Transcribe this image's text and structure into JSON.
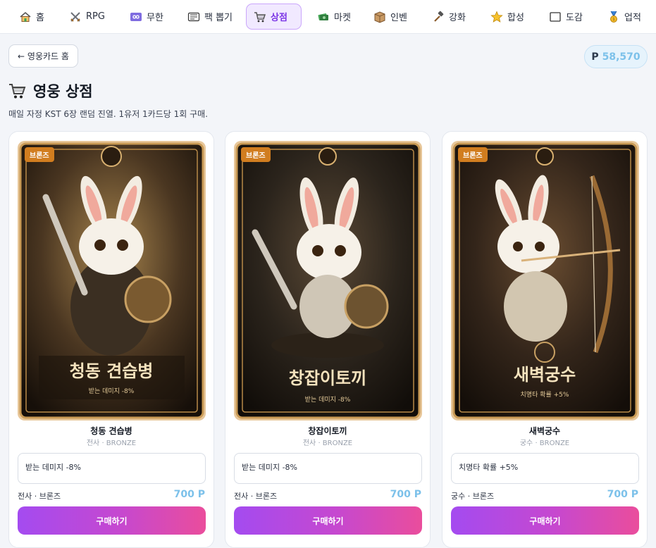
{
  "nav": {
    "items": [
      {
        "label": "홈",
        "icon": "home-icon"
      },
      {
        "label": "RPG",
        "icon": "crossed-swords-icon"
      },
      {
        "label": "무한",
        "icon": "infinity-icon"
      },
      {
        "label": "팩 뽑기",
        "icon": "card-pack-icon"
      },
      {
        "label": "상점",
        "icon": "shopping-cart-icon"
      },
      {
        "label": "마켓",
        "icon": "money-icon"
      },
      {
        "label": "인벤",
        "icon": "inventory-box-icon"
      },
      {
        "label": "강화",
        "icon": "hammer-icon"
      },
      {
        "label": "합성",
        "icon": "star-icon"
      },
      {
        "label": "도감",
        "icon": "book-icon"
      },
      {
        "label": "업적",
        "icon": "medal-icon"
      }
    ],
    "active": "상점"
  },
  "back_button": "← 영웅카드 홈",
  "points": {
    "symbol": "P",
    "value": "58,570"
  },
  "page": {
    "title": "영웅 상점",
    "title_icon": "shopping-cart-icon",
    "subtitle": "매일 자정 KST 6장 랜덤 진열. 1유저 1카드당 1회 구매."
  },
  "cards": [
    {
      "badge": "브론즈",
      "art_title": "청동 견습병",
      "art_caption": "받는 데미지 -8%",
      "name": "청동 견습병",
      "class_line": "전사 · BRONZE",
      "effect": "받는 데미지 -8%",
      "meta": "전사 · 브론즈",
      "price": "700 P",
      "buy_label": "구매하기",
      "art_icon": "sword-shield-rabbit-icon"
    },
    {
      "badge": "브론즈",
      "art_title": "창잡이토끼",
      "art_caption": "받는 데미지 -8%",
      "name": "창잡이토끼",
      "class_line": "전사 · BRONZE",
      "effect": "받는 데미지 -8%",
      "meta": "전사 · 브론즈",
      "price": "700 P",
      "buy_label": "구매하기",
      "art_icon": "sword-shield-rabbit-icon"
    },
    {
      "badge": "브론즈",
      "art_title": "새벽궁수",
      "art_caption": "치명타 확률 +5%",
      "name": "새벽궁수",
      "class_line": "궁수 · BRONZE",
      "effect": "치명타 확률 +5%",
      "meta": "궁수 · 브론즈",
      "price": "700 P",
      "buy_label": "구매하기",
      "art_icon": "archer-rabbit-icon"
    }
  ],
  "colors": {
    "accent_purple": "#7b34e6",
    "badge_bronze": "#d17d1f",
    "price_blue": "#7cc1ea",
    "buy_gradient_start": "#a44bf0",
    "buy_gradient_end": "#ea4d9c"
  }
}
